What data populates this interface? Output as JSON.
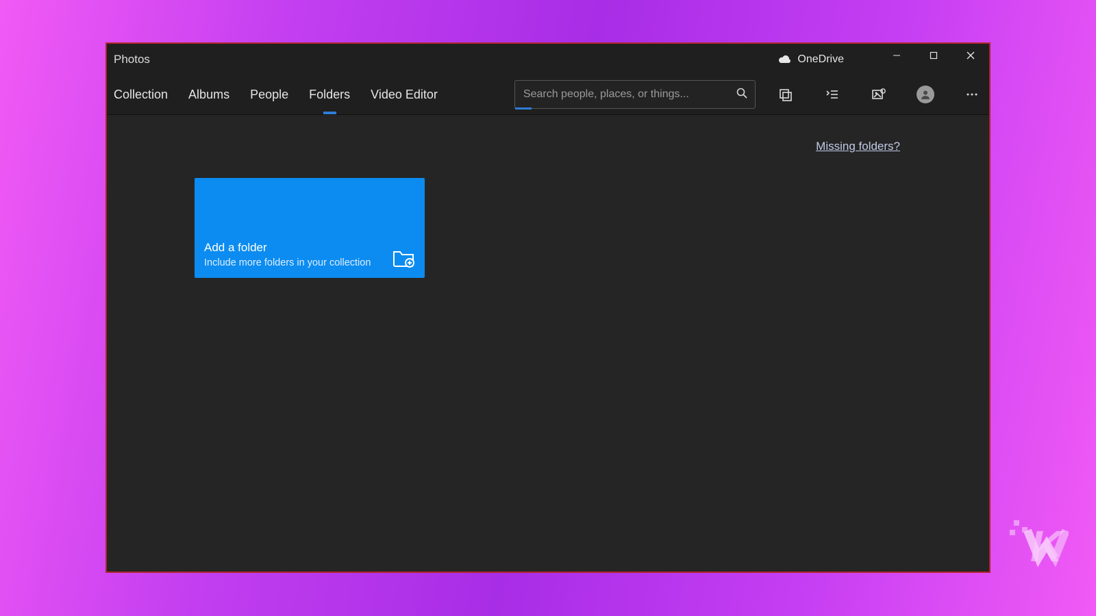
{
  "app": {
    "title": "Photos"
  },
  "onedrive": {
    "label": "OneDrive"
  },
  "tabs": {
    "collection": "Collection",
    "albums": "Albums",
    "people": "People",
    "folders": "Folders",
    "video_editor": "Video Editor",
    "active": "folders"
  },
  "search": {
    "placeholder": "Search people, places, or things..."
  },
  "content": {
    "missing_folders_link": "Missing folders?",
    "add_card": {
      "title": "Add a folder",
      "subtitle": "Include more folders in your collection"
    }
  },
  "colors": {
    "accent_blue": "#0c8cf0",
    "window_border": "#b0262d",
    "app_bg": "#1f1f1f",
    "content_bg": "#262525"
  }
}
